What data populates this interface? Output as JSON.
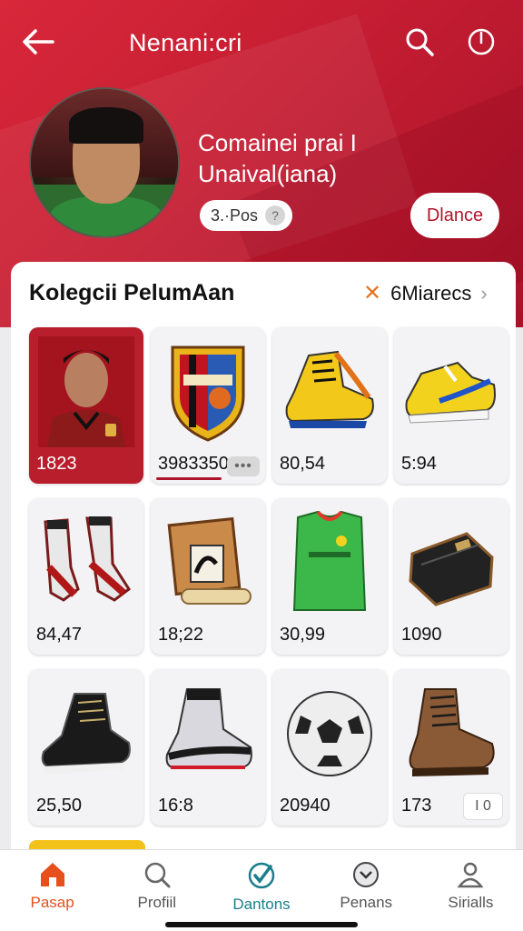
{
  "header": {
    "title": "Nenani:cri",
    "back_icon": "arrow-left-icon",
    "search_icon": "search-icon",
    "power_icon": "power-icon"
  },
  "profile": {
    "name_line1": "Comainei prai I",
    "name_line2": "Unaival(iana)",
    "position": "3.·Pos",
    "help_symbol": "?",
    "action_label": "Dlance"
  },
  "collection": {
    "title": "Kolegcii PelumAan",
    "action_label": "6Miarecs",
    "items": [
      {
        "value": "1823",
        "icon": "player-card-icon"
      },
      {
        "value": "3983350",
        "icon": "club-crest-icon",
        "badge": "•••"
      },
      {
        "value": "80,54",
        "icon": "yellow-boot-icon"
      },
      {
        "value": "5:94",
        "icon": "yellow-sneaker-icon"
      },
      {
        "value": "84,47",
        "icon": "red-boots-icon"
      },
      {
        "value": "18;22",
        "icon": "sign-board-icon"
      },
      {
        "value": "30,99",
        "icon": "green-jersey-icon"
      },
      {
        "value": "1090",
        "icon": "wallet-bag-icon"
      },
      {
        "value": "25,50",
        "icon": "black-boot-icon"
      },
      {
        "value": "16:8",
        "icon": "silver-boot-icon"
      },
      {
        "value": "20940",
        "icon": "football-icon"
      },
      {
        "value": "173",
        "icon": "brown-boot-icon",
        "badge": "I 0"
      }
    ]
  },
  "nav": {
    "items": [
      {
        "label": "Pasap",
        "icon": "home-icon"
      },
      {
        "label": "Profiil",
        "icon": "search-icon"
      },
      {
        "label": "Dantons",
        "icon": "check-badge-icon"
      },
      {
        "label": "Penans",
        "icon": "chevron-circle-icon"
      },
      {
        "label": "Sirialls",
        "icon": "user-icon"
      }
    ]
  },
  "colors": {
    "header_red": "#c51d32",
    "accent_orange": "#e6501c",
    "teal": "#1a7f8c"
  }
}
